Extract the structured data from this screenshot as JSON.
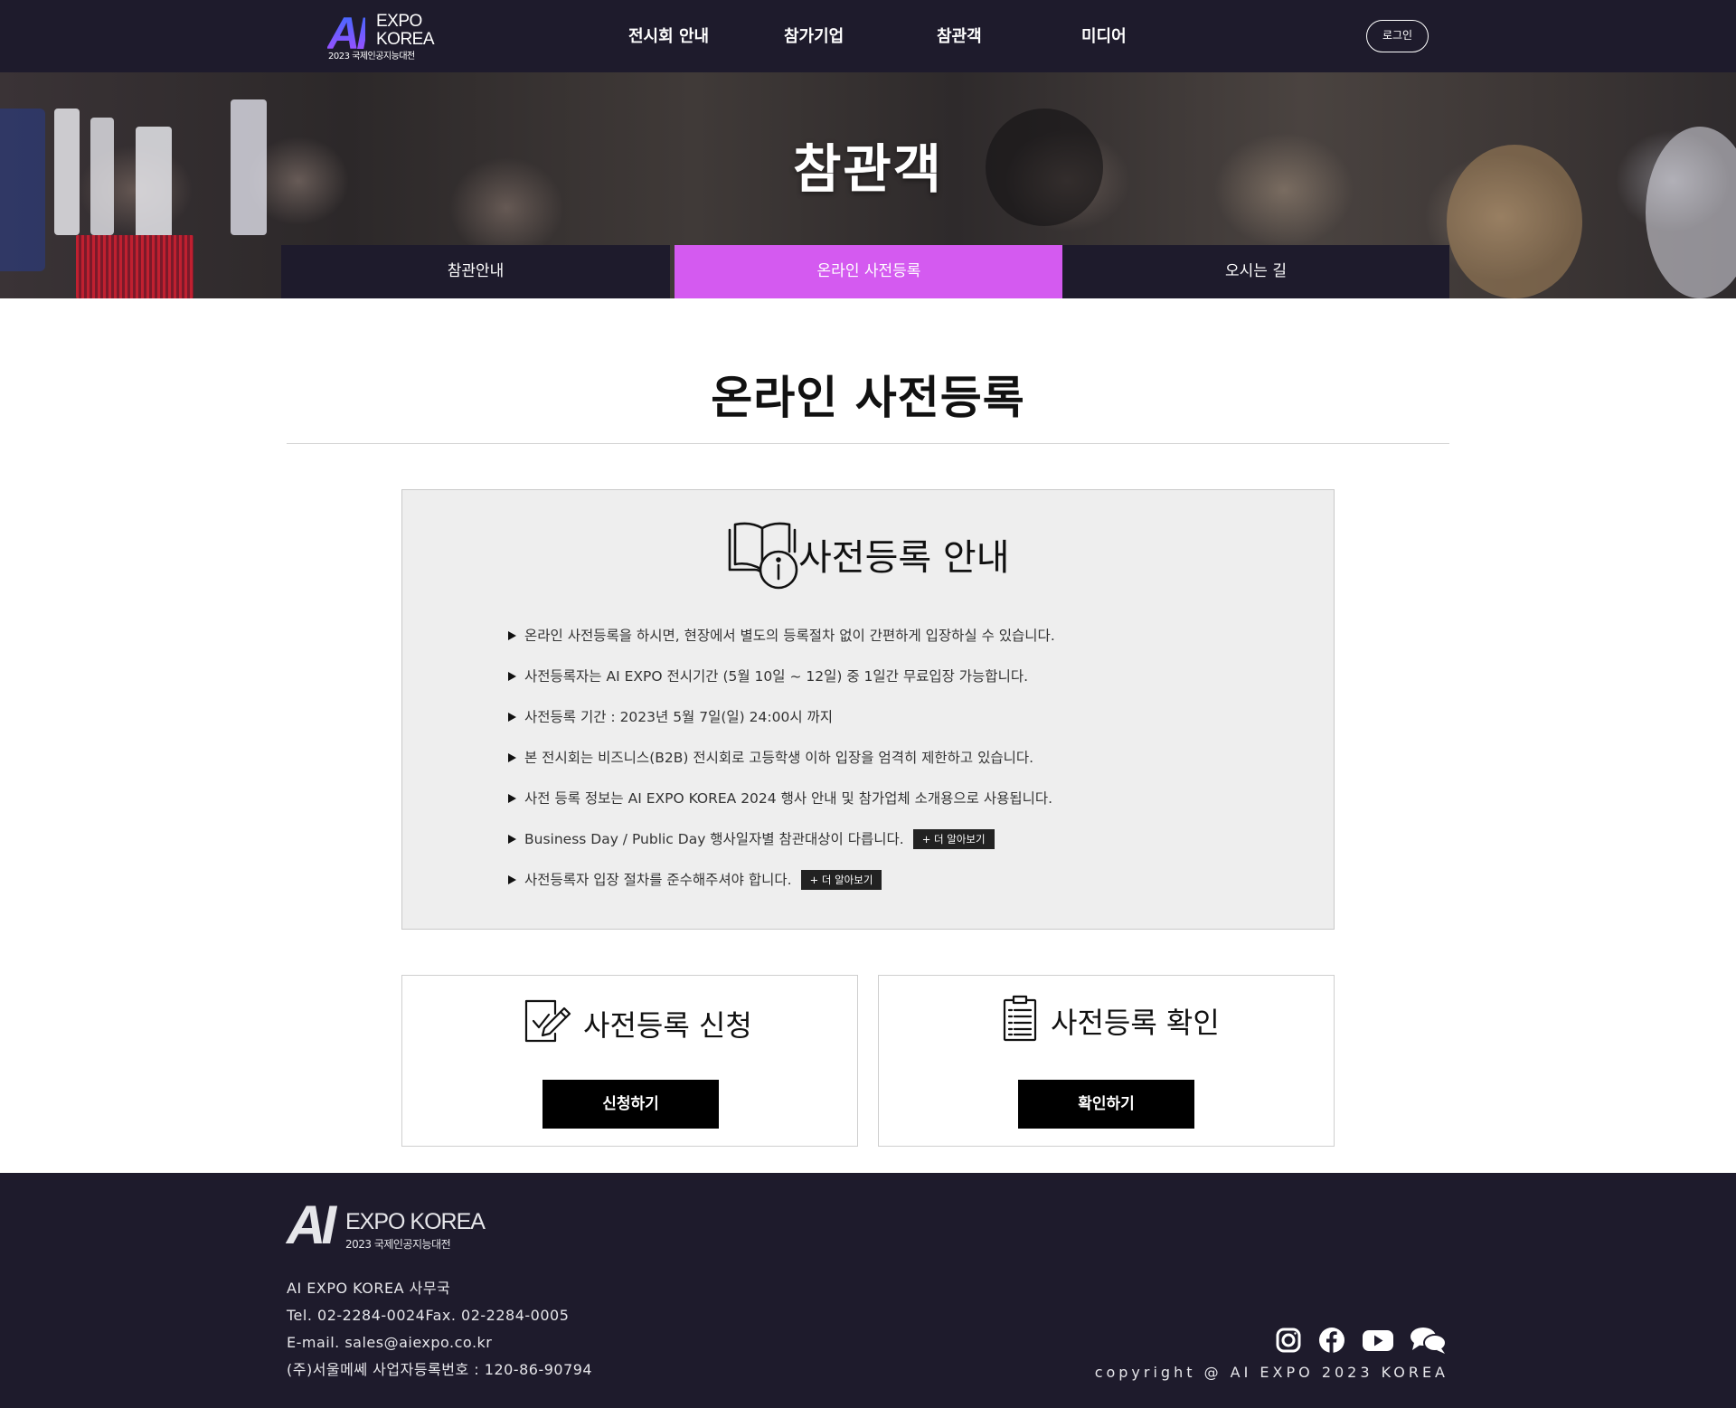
{
  "header": {
    "logo_ai": "AI",
    "logo_expo": "EXPO",
    "logo_korea": "KOREA",
    "logo_sub": "2023 국제인공지능대전",
    "nav": [
      "전시회 안내",
      "참가기업",
      "참관객",
      "미디어"
    ],
    "login_label": "로그인"
  },
  "hero": {
    "title": "참관객",
    "tabs": [
      {
        "label": "참관안내",
        "active": false
      },
      {
        "label": "온라인 사전등록",
        "active": true
      },
      {
        "label": "오시는 길",
        "active": false
      }
    ]
  },
  "main": {
    "page_title": "온라인 사전등록",
    "info": {
      "heading": "사전등록 안내",
      "items": [
        {
          "text": "온라인 사전등록을 하시면, 현장에서 별도의 등록절차 없이 간편하게 입장하실 수 있습니다.",
          "more": ""
        },
        {
          "text": "사전등록자는 AI EXPO 전시기간 (5월 10일 ~ 12일) 중 1일간 무료입장 가능합니다.",
          "more": ""
        },
        {
          "text": "사전등록 기간 : 2023년 5월 7일(일) 24:00시 까지",
          "more": ""
        },
        {
          "text": "본 전시회는 비즈니스(B2B) 전시회로 고등학생 이하 입장을 엄격히 제한하고 있습니다.",
          "more": ""
        },
        {
          "text": "사전 등록 정보는 AI EXPO KOREA 2024 행사 안내 및 참가업체 소개용으로 사용됩니다.",
          "more": ""
        },
        {
          "text": "Business Day / Public Day 행사일자별 참관대상이 다릅니다.",
          "more": "+ 더 알아보기"
        },
        {
          "text": "사전등록자 입장 절차를 준수해주셔야 합니다.",
          "more": "+ 더 알아보기"
        }
      ]
    },
    "cards": [
      {
        "title": "사전등록 신청",
        "button": "신청하기",
        "icon": "edit-document-icon"
      },
      {
        "title": "사전등록 확인",
        "button": "확인하기",
        "icon": "clipboard-list-icon"
      }
    ]
  },
  "footer": {
    "logo_ai": "AI",
    "logo_expo": "EXPO KOREA",
    "logo_sub": "2023 국제인공지능대전",
    "office": "AI EXPO KOREA 사무국",
    "tel_fax": "Tel. 02-2284-0024Fax. 02-2284-0005",
    "email": "E-mail. sales@aiexpo.co.kr",
    "business": "(주)서울메쎄 사업자등록번호 : 120-86-90794",
    "social_icons": [
      "instagram-icon",
      "facebook-icon",
      "youtube-icon",
      "chat-icon"
    ],
    "copyright": "copyright @ AI EXPO 2023 KOREA"
  },
  "colors": {
    "header_bg": "#1e1b2c",
    "active_tab": "#d45af0",
    "info_bg": "#eeeeee",
    "button_bg": "#000000"
  }
}
